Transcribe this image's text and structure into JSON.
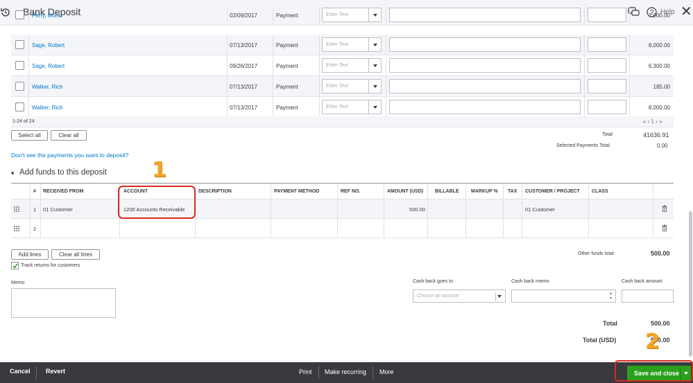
{
  "header": {
    "title": "Bank Deposit",
    "help": "Help"
  },
  "payments": {
    "rows": [
      {
        "name": "Perry, Doris",
        "date": "02/09/2017",
        "type": "Payment",
        "placeholder": "Enter Text",
        "amount": "7,000.00"
      },
      {
        "name": "Sage, Robert",
        "date": "07/13/2017",
        "type": "Payment",
        "placeholder": "Enter Text",
        "amount": "8,000.00"
      },
      {
        "name": "Sage, Robert",
        "date": "09/26/2017",
        "type": "Payment",
        "placeholder": "Enter Text",
        "amount": "6,300.00"
      },
      {
        "name": "Walker, Rich",
        "date": "07/13/2017",
        "type": "Payment",
        "placeholder": "Enter Text",
        "amount": "185.00"
      },
      {
        "name": "Walker, Rich",
        "date": "07/13/2017",
        "type": "Payment",
        "placeholder": "Enter Text",
        "amount": "8,000.00"
      }
    ],
    "count": "1-24 of 24",
    "pager": "«  ‹  1  ›  »",
    "select_all": "Select all",
    "clear_all": "Clear all",
    "total_label": "Total",
    "total_value": "41636.91",
    "selected_label": "Selected Payments Total",
    "selected_value": "0.00",
    "missing_link": "Don't see the payments you want to deposit?"
  },
  "funds": {
    "heading": "Add funds to this deposit",
    "columns": [
      "#",
      "RECEIVED FROM",
      "ACCOUNT",
      "DESCRIPTION",
      "PAYMENT METHOD",
      "REF NO.",
      "AMOUNT (USD)",
      "BILLABLE",
      "MARKUP %",
      "TAX",
      "CUSTOMER / PROJECT",
      "CLASS"
    ],
    "rows": [
      {
        "num": "1",
        "received_from": "01 Customer",
        "account": "1200 Accounts Receivable",
        "amount": "500.00",
        "customer": "01 Customer"
      },
      {
        "num": "2",
        "received_from": "",
        "account": "",
        "amount": "",
        "customer": ""
      }
    ],
    "add_lines": "Add lines",
    "clear_all_lines": "Clear all lines",
    "track_returns": "Track returns for customers",
    "other_total_label": "Other funds total",
    "other_total_value": "500.00"
  },
  "memo_label": "Memo",
  "cashback": {
    "goes_to_label": "Cash back goes to",
    "goes_to_placeholder": "Choose an account",
    "memo_label": "Cash back memo",
    "amount_label": "Cash back amount"
  },
  "totals": {
    "total_label": "Total",
    "total_value": "500.00",
    "total_usd_label": "Total (USD)",
    "total_usd_value": "500.00"
  },
  "annotations": {
    "one": "1",
    "two": "2"
  },
  "bottombar": {
    "cancel": "Cancel",
    "revert": "Revert",
    "print": "Print",
    "make_recurring": "Make recurring",
    "more": "More",
    "save_close": "Save and close"
  },
  "colors": {
    "link": "#0077c5",
    "save": "#2ca01c",
    "annotation": "#f5a623",
    "highlight": "#d52b1e"
  }
}
